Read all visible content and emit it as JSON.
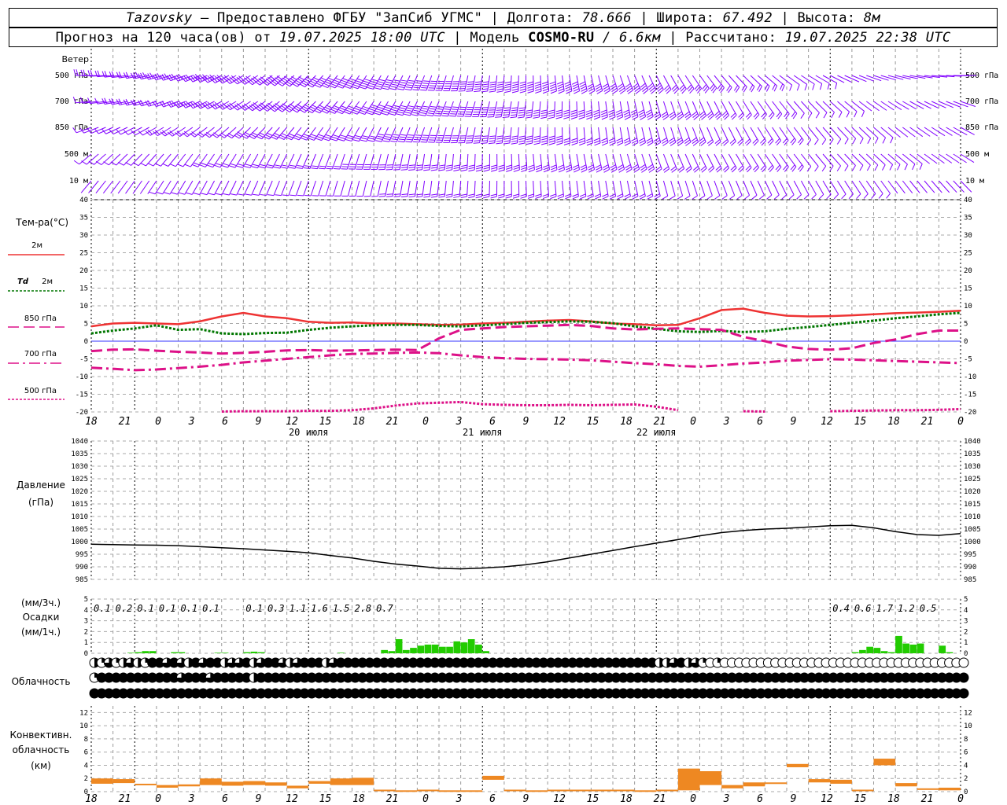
{
  "header": {
    "station": "Tazovsky",
    "dash": " – ",
    "provided": "Предоставлено ФГБУ \"ЗапСиб УГМС\"",
    "sep": " | ",
    "lon_label": "Долгота: ",
    "lon": "78.666",
    "lat_label": "Широта: ",
    "lat": "67.492",
    "alt_label": "Высота: ",
    "alt": "8м"
  },
  "subheader": {
    "forecast_label": "Прогноз на 120 часа(ов) от ",
    "init": "19.07.2025 18:00 UTC",
    "model_label": "Модель ",
    "model": "COSMO-RU",
    "resolution": " / 6.6км",
    "calc_label": "Рассчитано: ",
    "calc": "19.07.2025 22:38 UTC"
  },
  "labels": {
    "wind": "Ветер",
    "temp": "Тем-ра(°С)",
    "t2m": "2м",
    "td": "Td",
    "td2": "2м",
    "t850": "850 гПа",
    "t700": "700 гПа",
    "t500": "500 гПа",
    "pressure1": "Давление",
    "pressure2": "(гПа)",
    "precip1": "(мм/3ч.)",
    "precip2": "Осадки",
    "precip3": "(мм/1ч.)",
    "clouds": "Облачность",
    "conv1": "Конвективн.",
    "conv2": "облачность",
    "conv3": "(км)"
  },
  "wind_levels": [
    "500 гПа",
    "700 гПа",
    "850 гПа",
    "500 м",
    "10  м"
  ],
  "hour_ticks": [
    "18",
    "21",
    "0",
    "3",
    "6",
    "9",
    "12",
    "15",
    "18",
    "21",
    "0",
    "3",
    "6",
    "9",
    "12",
    "15",
    "18",
    "21",
    "0",
    "3",
    "6",
    "9",
    "12",
    "15",
    "18",
    "21",
    "0"
  ],
  "dates": [
    "20 июля",
    "21 июля",
    "22 июля"
  ],
  "colors": {
    "wind": "#8000ff",
    "t2m": "#ee3333",
    "td": "#007700",
    "t850": "#dd1188",
    "precip_bar": "#22cc00",
    "conv_bar": "#ee8822",
    "zero_line": "#3333ff"
  },
  "chart_data": [
    {
      "type": "line",
      "title": "Тем-ра(°С)",
      "x_hours": [
        0,
        3,
        6,
        9,
        12,
        15,
        18,
        21,
        24,
        27,
        30,
        33,
        36,
        39,
        42,
        45,
        48,
        51,
        54,
        57,
        60,
        63,
        66,
        69,
        72,
        75,
        78,
        81,
        84,
        87,
        90,
        93,
        96,
        99,
        102,
        105,
        108,
        111,
        114,
        117,
        120
      ],
      "series": [
        {
          "name": "2м",
          "values": [
            4.2,
            5.0,
            5.2,
            5.0,
            4.8,
            5.6,
            7.0,
            8.0,
            7.0,
            6.5,
            5.5,
            5.2,
            5.3,
            5.0,
            5.0,
            4.8,
            4.6,
            4.7,
            5.0,
            5.2,
            5.5,
            5.8,
            6.0,
            5.6,
            5.0,
            4.8,
            4.5,
            4.6,
            6.5,
            8.8,
            9.2,
            8.0,
            7.2,
            7.0,
            7.1,
            7.3,
            7.6,
            7.9,
            8.1,
            8.3,
            8.6
          ]
        },
        {
          "name": "Td 2м",
          "values": [
            2.2,
            3.0,
            3.6,
            4.5,
            3.2,
            3.4,
            2.2,
            2.0,
            2.3,
            2.4,
            3.2,
            3.8,
            4.2,
            4.5,
            4.6,
            4.6,
            4.3,
            4.2,
            4.5,
            4.8,
            5.2,
            5.4,
            5.6,
            5.5,
            5.1,
            4.2,
            3.5,
            2.8,
            2.6,
            2.9,
            2.6,
            2.8,
            3.5,
            4.0,
            4.6,
            5.2,
            5.8,
            6.5,
            7.0,
            7.6,
            8.0
          ]
        },
        {
          "name": "850 гПа",
          "values": [
            -2.8,
            -2.4,
            -2.3,
            -2.7,
            -3.0,
            -3.2,
            -3.5,
            -3.3,
            -3.0,
            -2.6,
            -2.5,
            -2.7,
            -2.6,
            -2.5,
            -2.4,
            -2.5,
            0.8,
            3.2,
            3.6,
            4.0,
            4.2,
            4.4,
            4.6,
            4.3,
            3.6,
            3.3,
            3.5,
            3.6,
            3.4,
            3.2,
            1.2,
            0.0,
            -1.5,
            -2.2,
            -2.4,
            -2.0,
            -0.5,
            0.5,
            2.0,
            3.0,
            3.0
          ]
        },
        {
          "name": "700 гПа",
          "values": [
            -7.5,
            -7.8,
            -8.2,
            -8.0,
            -7.6,
            -7.2,
            -6.7,
            -6.0,
            -5.5,
            -5.0,
            -4.5,
            -4.0,
            -3.6,
            -3.5,
            -3.3,
            -3.2,
            -3.4,
            -4.0,
            -4.5,
            -4.8,
            -5.0,
            -5.1,
            -5.2,
            -5.4,
            -5.8,
            -6.2,
            -6.5,
            -7.0,
            -7.2,
            -6.8,
            -6.3,
            -6.0,
            -5.5,
            -5.3,
            -5.1,
            -5.2,
            -5.4,
            -5.6,
            -5.8,
            -6.0,
            -6.2
          ]
        },
        {
          "name": "500 гПа",
          "values": [
            null,
            null,
            null,
            null,
            null,
            null,
            -19.9,
            -19.8,
            -19.8,
            -19.8,
            -19.7,
            -19.7,
            -19.5,
            -19.0,
            -18.2,
            -17.6,
            -17.4,
            -17.2,
            -17.8,
            -18.0,
            -18.1,
            -18.1,
            -18.0,
            -18.1,
            -18.0,
            -17.9,
            -18.5,
            -19.5,
            null,
            null,
            -19.8,
            -19.9,
            null,
            null,
            -19.8,
            -19.7,
            -19.6,
            -19.5,
            -19.5,
            -19.4,
            -19.2
          ]
        }
      ],
      "ylim": [
        -20,
        40
      ],
      "yticks": [
        -20,
        -15,
        -10,
        -5,
        0,
        5,
        10,
        15,
        20,
        25,
        30,
        35,
        40
      ]
    },
    {
      "type": "line",
      "title": "Давление (гПа)",
      "x_hours": [
        0,
        3,
        6,
        9,
        12,
        15,
        18,
        21,
        24,
        27,
        30,
        33,
        36,
        39,
        42,
        45,
        48,
        51,
        54,
        57,
        60,
        63,
        66,
        69,
        72,
        75,
        78,
        81,
        84,
        87,
        90,
        93,
        96,
        99,
        102,
        105,
        108,
        111,
        114,
        117,
        120
      ],
      "series": [
        {
          "name": "Давление",
          "values": [
            999.0,
            998.8,
            998.7,
            998.6,
            998.4,
            998.0,
            997.6,
            997.2,
            996.7,
            996.2,
            995.6,
            994.5,
            993.5,
            992.2,
            991.1,
            990.3,
            989.4,
            989.2,
            989.5,
            990.0,
            990.8,
            992.0,
            993.5,
            995.0,
            996.5,
            998.0,
            999.4,
            1000.8,
            1002.3,
            1003.6,
            1004.4,
            1005.0,
            1005.3,
            1005.8,
            1006.3,
            1006.5,
            1005.5,
            1004.0,
            1002.8,
            1002.5,
            1003.2
          ]
        }
      ],
      "ylim": [
        985,
        1040
      ],
      "yticks": [
        985,
        990,
        995,
        1000,
        1005,
        1010,
        1015,
        1020,
        1025,
        1030,
        1035,
        1040
      ]
    },
    {
      "type": "bar",
      "title": "Осадки",
      "x_hours": [
        0,
        3,
        6,
        9,
        12,
        15,
        18,
        21,
        24,
        27,
        30,
        33,
        36,
        39,
        42,
        45,
        48,
        51,
        54,
        57,
        60,
        63,
        66,
        69,
        72,
        75,
        78,
        81,
        84,
        87,
        90,
        93,
        96,
        99,
        102,
        105,
        108,
        111,
        114,
        117
      ],
      "values_hourly_3h_labels": [
        "",
        "",
        "0.1",
        "0.2",
        "0.1",
        "0.1",
        "0.1",
        "0.1",
        "",
        "0.1",
        "0.3",
        "1.1",
        "1.6",
        "1.5",
        "2.8",
        "0.7",
        "",
        "",
        "",
        "",
        "",
        "",
        "",
        "",
        "",
        "",
        "",
        "",
        "0.4",
        "0.6",
        "1.7",
        "1.2",
        "0.5",
        ""
      ],
      "three_hour_labels": [
        {
          "h": 3,
          "v": "0.1"
        },
        {
          "h": 6,
          "v": "0.2"
        },
        {
          "h": 9,
          "v": "0.1"
        },
        {
          "h": 12,
          "v": "0.1"
        },
        {
          "h": 15,
          "v": "0.1"
        },
        {
          "h": 18,
          "v": "0.1"
        },
        {
          "h": 24,
          "v": "0.1"
        },
        {
          "h": 27,
          "v": "0.3"
        },
        {
          "h": 30,
          "v": "1.1"
        },
        {
          "h": 33,
          "v": "1.6"
        },
        {
          "h": 36,
          "v": "1.5"
        },
        {
          "h": 39,
          "v": "2.8"
        },
        {
          "h": 42,
          "v": "0.7"
        },
        {
          "h": 105,
          "v": "0.4"
        },
        {
          "h": 108,
          "v": "0.6"
        },
        {
          "h": 111,
          "v": "1.7"
        },
        {
          "h": 114,
          "v": "1.2"
        },
        {
          "h": 117,
          "v": "0.5"
        }
      ],
      "hourly_mm": [
        0,
        0,
        0,
        0,
        0,
        0.05,
        0.1,
        0.2,
        0.2,
        0,
        0,
        0.1,
        0.1,
        0,
        0,
        0,
        0,
        0.05,
        0.05,
        0,
        0,
        0.1,
        0.15,
        0.1,
        0,
        0,
        0,
        0,
        0,
        0,
        0,
        0,
        0,
        0,
        0.05,
        0,
        0,
        0,
        0,
        0,
        0.3,
        0.2,
        1.3,
        0.3,
        0.5,
        0.7,
        0.8,
        0.8,
        0.6,
        0.6,
        1.1,
        1.0,
        1.3,
        0.8,
        0.2,
        0,
        0,
        0,
        0,
        0,
        0,
        0,
        0,
        0,
        0,
        0,
        0,
        0,
        0,
        0,
        0,
        0,
        0,
        0,
        0,
        0,
        0,
        0,
        0,
        0,
        0,
        0,
        0,
        0,
        0,
        0,
        0,
        0,
        0,
        0,
        0,
        0,
        0,
        0,
        0,
        0,
        0,
        0,
        0,
        0,
        0,
        0,
        0,
        0,
        0,
        0.1,
        0.3,
        0.6,
        0.5,
        0.2,
        0.1,
        1.6,
        0.9,
        0.8,
        0.9,
        0,
        0,
        0.7,
        0.1,
        0
      ],
      "ylim": [
        0,
        5
      ],
      "yticks": [
        0,
        1,
        2,
        3,
        4,
        5
      ]
    },
    {
      "type": "bar",
      "title": "Конвективн. облачность (км)",
      "x_hours": [
        0,
        3,
        6,
        9,
        12,
        15,
        18,
        21,
        24,
        27,
        30,
        33,
        36,
        39,
        42,
        45,
        48,
        51,
        54,
        57,
        60,
        63,
        66,
        69,
        72,
        75,
        78,
        81,
        84,
        87,
        90,
        93,
        96,
        99,
        102,
        105,
        108,
        111,
        114,
        117
      ],
      "base_km": [
        1.2,
        1.3,
        1.0,
        0.6,
        0.8,
        1.0,
        0.9,
        1.0,
        0.9,
        0.5,
        1.2,
        1.0,
        1.0,
        0.2,
        0.1,
        0.2,
        0.1,
        0.1,
        1.8,
        0.2,
        0.1,
        0.2,
        0.2,
        0.2,
        0.2,
        0.1,
        0.2,
        0.2,
        3.1,
        0.5,
        0.8,
        1.2,
        3.7,
        1.4,
        1.2,
        0.2,
        4.0,
        0.8,
        0.4,
        0.2
      ],
      "top_km": [
        2.0,
        1.9,
        1.2,
        1.0,
        1.1,
        2.0,
        1.5,
        1.6,
        1.4,
        0.9,
        1.6,
        2.0,
        2.1,
        0.3,
        0.2,
        0.3,
        0.2,
        0.2,
        2.4,
        0.3,
        0.2,
        0.3,
        0.3,
        0.3,
        0.3,
        0.2,
        0.3,
        3.5,
        1.0,
        1.0,
        1.4,
        1.4,
        4.2,
        1.9,
        1.8,
        0.3,
        5.0,
        1.3,
        0.5,
        0.6
      ],
      "ylim": [
        0,
        13
      ],
      "yticks": [
        0,
        2,
        4,
        6,
        8,
        10,
        12
      ]
    }
  ],
  "clouds": {
    "rows": [
      [
        2,
        1,
        3,
        1,
        2,
        3,
        2,
        1,
        4,
        4,
        3,
        4,
        3,
        2,
        4,
        3,
        4,
        4,
        2,
        3,
        3,
        4,
        2,
        3,
        4,
        4,
        3,
        2,
        3,
        4,
        4,
        4,
        2,
        3,
        4,
        4,
        4,
        4,
        4,
        4,
        4,
        4,
        4,
        4,
        4,
        4,
        4,
        4,
        4,
        4,
        4,
        4,
        4,
        4,
        4,
        4,
        4,
        4,
        4,
        4,
        4,
        4,
        4,
        4,
        4,
        4,
        4,
        4,
        4,
        4,
        4,
        4,
        4,
        4,
        4,
        4,
        4,
        4,
        2,
        2,
        3,
        4,
        2,
        3,
        1,
        0,
        1,
        0,
        0,
        0,
        0,
        0,
        0,
        0,
        0,
        0,
        0,
        0,
        0,
        0,
        0,
        0,
        0,
        0,
        0,
        0,
        0,
        0,
        0,
        0,
        0,
        0,
        0,
        0,
        0,
        0,
        0,
        0,
        0,
        0,
        0,
        0,
        0,
        0,
        0,
        0,
        0,
        0,
        0,
        0,
        1,
        2,
        3,
        3,
        2,
        2,
        3,
        4,
        2,
        3,
        3,
        4
      ],
      [
        1,
        4,
        4,
        4,
        4,
        4,
        4,
        4,
        4,
        4,
        4,
        4,
        3,
        4,
        4,
        4,
        3,
        4,
        4,
        4,
        4,
        4,
        2,
        4,
        4,
        4,
        4,
        4,
        4,
        4,
        4,
        4,
        4,
        4,
        4,
        4,
        4,
        4,
        4,
        4,
        4,
        4,
        4,
        4,
        4,
        4,
        4,
        4,
        4,
        4,
        4,
        4,
        4,
        4,
        4,
        4,
        4,
        4,
        4,
        4,
        4,
        4,
        4,
        4,
        4,
        4,
        4,
        4,
        4,
        4,
        4,
        4,
        4,
        4,
        4,
        4,
        4,
        4,
        4,
        4,
        4,
        4,
        4,
        4,
        4,
        4,
        4,
        4,
        4,
        4,
        4,
        4,
        4,
        4,
        4,
        4,
        4,
        4,
        4,
        4,
        4,
        4,
        4,
        4,
        4,
        4,
        4,
        4,
        4,
        4,
        4,
        4,
        4,
        4,
        4,
        4,
        4,
        4,
        4,
        4,
        4,
        4,
        4,
        4,
        4,
        4,
        4,
        4,
        4,
        4,
        4,
        4,
        4,
        4,
        4,
        4,
        4,
        4,
        4,
        4,
        4,
        4,
        4,
        4
      ],
      [
        4,
        4,
        4,
        4,
        4,
        4,
        4,
        4,
        4,
        4,
        4,
        4,
        4,
        4,
        4,
        4,
        4,
        4,
        4,
        4,
        4,
        4,
        4,
        4,
        4,
        4,
        4,
        4,
        4,
        4,
        4,
        4,
        4,
        4,
        4,
        4,
        4,
        4,
        4,
        4,
        4,
        4,
        4,
        4,
        4,
        4,
        4,
        4,
        4,
        4,
        4,
        4,
        4,
        4,
        4,
        4,
        4,
        4,
        4,
        4,
        4,
        4,
        4,
        4,
        4,
        4,
        4,
        4,
        4,
        4,
        4,
        4,
        4,
        4,
        4,
        4,
        4,
        4,
        4,
        4,
        4,
        4,
        4,
        4,
        4,
        4,
        4,
        4,
        4,
        4,
        4,
        4,
        4,
        4,
        4,
        4,
        4,
        4,
        4,
        4,
        4,
        4,
        4,
        4,
        4,
        4,
        4,
        4,
        4,
        4,
        4,
        4,
        4,
        4,
        4,
        4,
        4,
        4,
        4,
        4,
        4,
        4,
        4,
        4,
        4,
        4,
        4,
        4,
        4,
        4,
        4,
        4,
        4,
        4,
        4,
        4,
        4,
        4,
        4,
        4,
        4,
        4,
        4
      ]
    ]
  }
}
